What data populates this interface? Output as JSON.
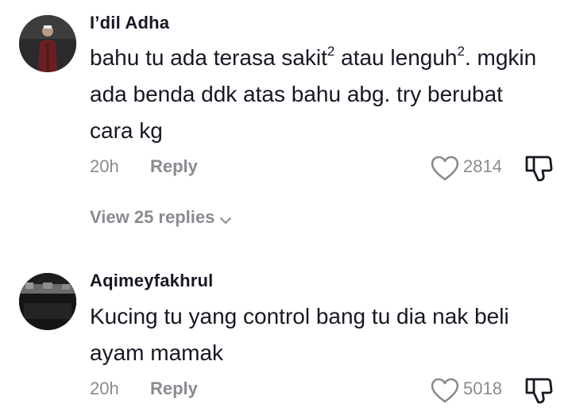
{
  "comments": [
    {
      "username": "I’dil Adha",
      "text_parts": {
        "a": "bahu tu ada terasa sakit",
        "a_sup": "2",
        "b": " atau lenguh",
        "b_sup": "2",
        "c": ". mgkin ada benda ddk atas bahu abg. try berubat cara kg"
      },
      "time": "20h",
      "reply_label": "Reply",
      "like_count": "2814",
      "view_replies_label": "View 25 replies"
    },
    {
      "username": "Aqimeyfakhrul",
      "text": "Kucing tu yang control bang tu dia nak beli ayam mamak",
      "time": "20h",
      "reply_label": "Reply",
      "like_count": "5018"
    }
  ],
  "icons": {
    "like": "heart-outline-icon",
    "dislike": "thumbs-down-icon",
    "chevron": "chevron-down-icon"
  },
  "colors": {
    "text_primary": "#161823",
    "text_secondary": "#8a8b91",
    "background": "#ffffff"
  }
}
